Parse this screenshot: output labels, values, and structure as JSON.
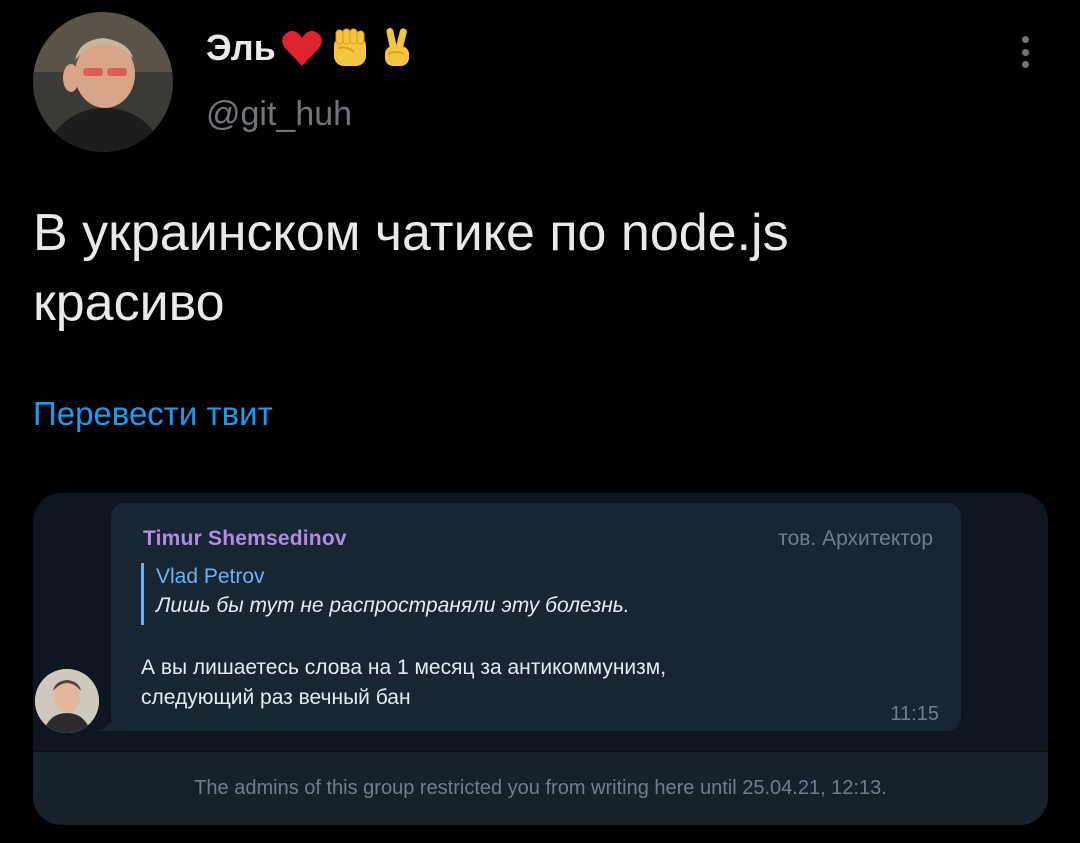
{
  "author": {
    "display_name": "Эль",
    "emojis": [
      "red-heart",
      "raised-fist",
      "victory-hand"
    ],
    "handle": "@git_huh",
    "avatar": "profile-photo"
  },
  "tweet": {
    "text_line1": "В украинском чатике по node.js",
    "text_line2": "красиво",
    "translate_label": "Перевести твит"
  },
  "telegram": {
    "sender_name": "Timur Shemsedinov",
    "sender_title": "тов. Архитектор",
    "reply_author": "Vlad Petrov",
    "reply_text": "Лишь бы тут не распространяли эту болезнь.",
    "message_line1": "А вы лишаетесь слова на 1 месяц за антикоммунизм,",
    "message_line2": "следующий раз вечный бан",
    "time": "11:15",
    "restricted_notice": "The admins of this group restricted you from writing here until 25.04.21, 12:13."
  },
  "colors": {
    "background": "#000000",
    "link": "#1d9bf0",
    "muted": "#71767b",
    "tg_sender": "#b08ce4",
    "tg_reply": "#6ab2f2"
  }
}
